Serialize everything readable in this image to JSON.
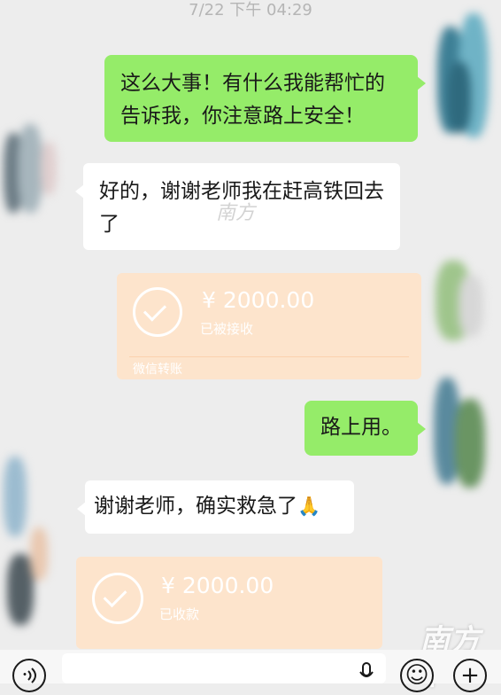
{
  "timestamp": "7/22 下午 04:29",
  "messages": {
    "m1": "这么大事！有什么我能帮忙的告诉我，你注意路上安全！",
    "m2": "好的，谢谢老师我在赶高铁回去了",
    "t1": {
      "amount": "¥ 2000.00",
      "status": "已被接收",
      "label": "微信转账"
    },
    "m3": "路上用。",
    "m4": "谢谢老师，确实救急了",
    "m4_emoji": "🙏",
    "t2": {
      "amount": "¥ 2000.00",
      "status": "已收款"
    }
  },
  "watermarks": {
    "small": "南方",
    "logo": "南方+"
  },
  "inputbar": {
    "voice_icon": "voice-icon",
    "emoji_icon": "smiley-icon",
    "plus_icon": "plus-icon",
    "emoji_glyph": "☺",
    "plus_glyph": "+"
  },
  "colors": {
    "background": "#ededed",
    "outgoing_bubble": "#95ec69",
    "incoming_bubble": "#ffffff",
    "transfer_card": "#fde4cc"
  }
}
